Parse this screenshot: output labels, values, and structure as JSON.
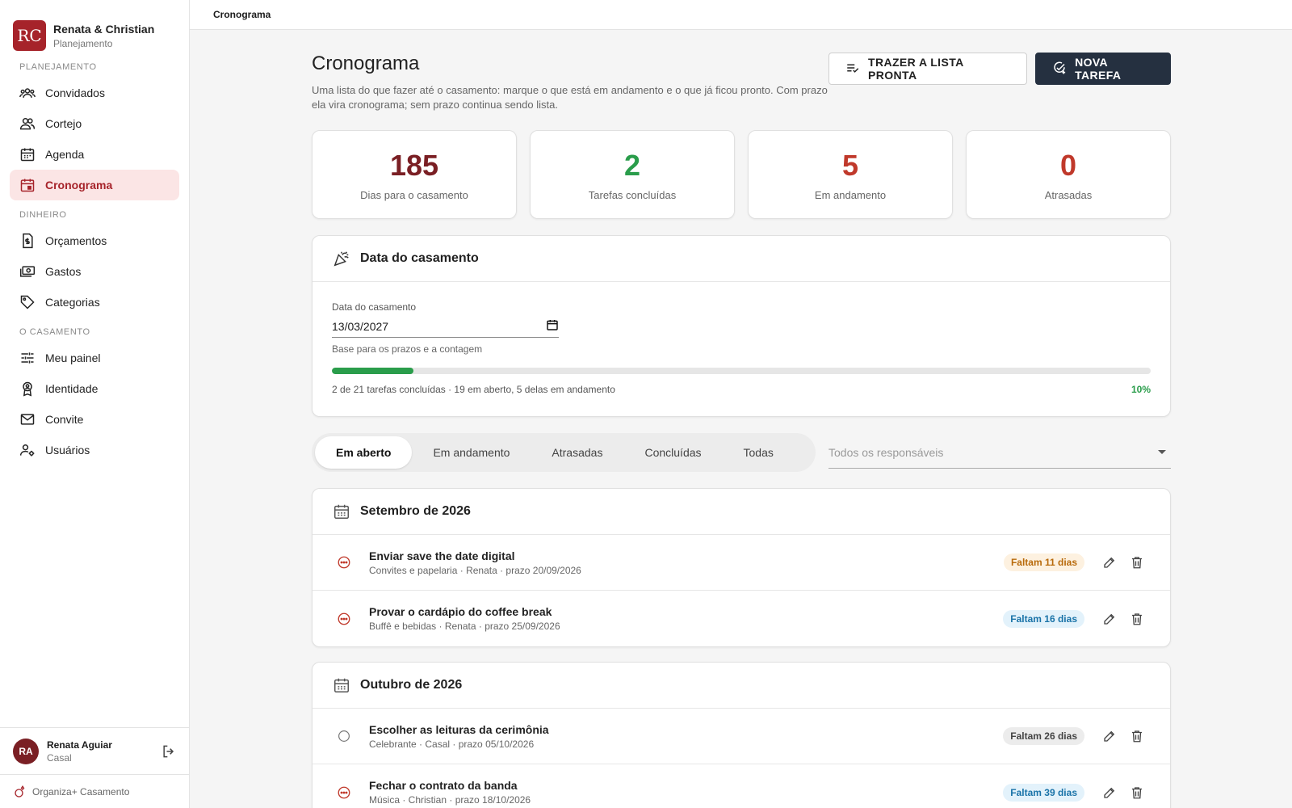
{
  "brand": {
    "monogram": "RC",
    "name": "Renata & Christian",
    "subtitle": "Planejamento"
  },
  "sidebar": {
    "sections": [
      {
        "label": "Planejamento",
        "items": [
          "Convidados",
          "Cortejo",
          "Agenda",
          "Cronograma"
        ]
      },
      {
        "label": "Dinheiro",
        "items": [
          "Orçamentos",
          "Gastos",
          "Categorias"
        ]
      },
      {
        "label": "O casamento",
        "items": [
          "Meu painel",
          "Identidade",
          "Convite",
          "Usuários"
        ]
      }
    ],
    "active_item": "Cronograma"
  },
  "user": {
    "initials": "RA",
    "name": "Renata Aguiar",
    "role": "Casal"
  },
  "footer_brand": "Organiza+ Casamento",
  "topbar": {
    "breadcrumb": "Cronograma"
  },
  "page": {
    "title": "Cronograma",
    "description": "Uma lista do que fazer até o casamento: marque o que está em andamento e o que já ficou pronto. Com prazo ela vira cronograma; sem prazo continua sendo lista.",
    "btn_import": "TRAZER A LISTA PRONTA",
    "btn_new": "NOVA TAREFA"
  },
  "stats": [
    {
      "value": "185",
      "label": "Dias para o casamento",
      "color": "#7a1f24"
    },
    {
      "value": "2",
      "label": "Tarefas concluídas",
      "color": "#2a9d4b"
    },
    {
      "value": "5",
      "label": "Em andamento",
      "color": "#c0392b"
    },
    {
      "value": "0",
      "label": "Atrasadas",
      "color": "#c0392b"
    }
  ],
  "date_card": {
    "title": "Data do casamento",
    "field_label": "Data do casamento",
    "value": "13/03/2027",
    "helper": "Base para os prazos e a contagem",
    "progress": 0.1,
    "summary": "2 de 21 tarefas concluídas · 19 em aberto, 5 delas em andamento",
    "percent": "10%"
  },
  "filters": {
    "tabs": [
      "Em aberto",
      "Em andamento",
      "Atrasadas",
      "Concluídas",
      "Todas"
    ],
    "active_tab": "Em aberto",
    "responsible_placeholder": "Todos os responsáveis"
  },
  "months": [
    {
      "title": "Setembro de 2026",
      "tasks": [
        {
          "title": "Enviar save the date digital",
          "meta": "Convites e papelaria · Renata · prazo 20/09/2026",
          "status": "in-progress",
          "chip": "Faltam 11 dias",
          "chip_tone": "orange"
        },
        {
          "title": "Provar o cardápio do coffee break",
          "meta": "Buffê e bebidas · Renata · prazo 25/09/2026",
          "status": "in-progress",
          "chip": "Faltam 16 dias",
          "chip_tone": "blue"
        }
      ]
    },
    {
      "title": "Outubro de 2026",
      "tasks": [
        {
          "title": "Escolher as leituras da cerimônia",
          "meta": "Celebrante · Casal · prazo 05/10/2026",
          "status": "open",
          "chip": "Faltam 26 dias",
          "chip_tone": "grey"
        },
        {
          "title": "Fechar o contrato da banda",
          "meta": "Música · Christian · prazo 18/10/2026",
          "status": "in-progress",
          "chip": "Faltam 39 dias",
          "chip_tone": "blue"
        }
      ]
    }
  ],
  "colors": {
    "accent": "#a6232a",
    "active_bg": "#fbe5e5",
    "dark_button": "#253040",
    "success": "#2a9d4b"
  }
}
